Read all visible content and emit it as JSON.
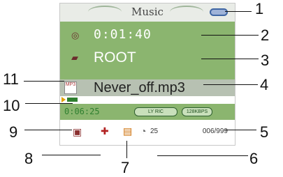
{
  "title": "Music",
  "time": "0:01:40",
  "folder": "ROOT",
  "track": "Never_off.mp3",
  "elapsed": "0:06:25",
  "pill1": "LY RIC",
  "pill2": "128KBPS",
  "volume": "25",
  "counter": "006/999",
  "annotation_numbers": [
    "1",
    "2",
    "3",
    "4",
    "5",
    "6",
    "7",
    "8",
    "9",
    "10",
    "11"
  ]
}
